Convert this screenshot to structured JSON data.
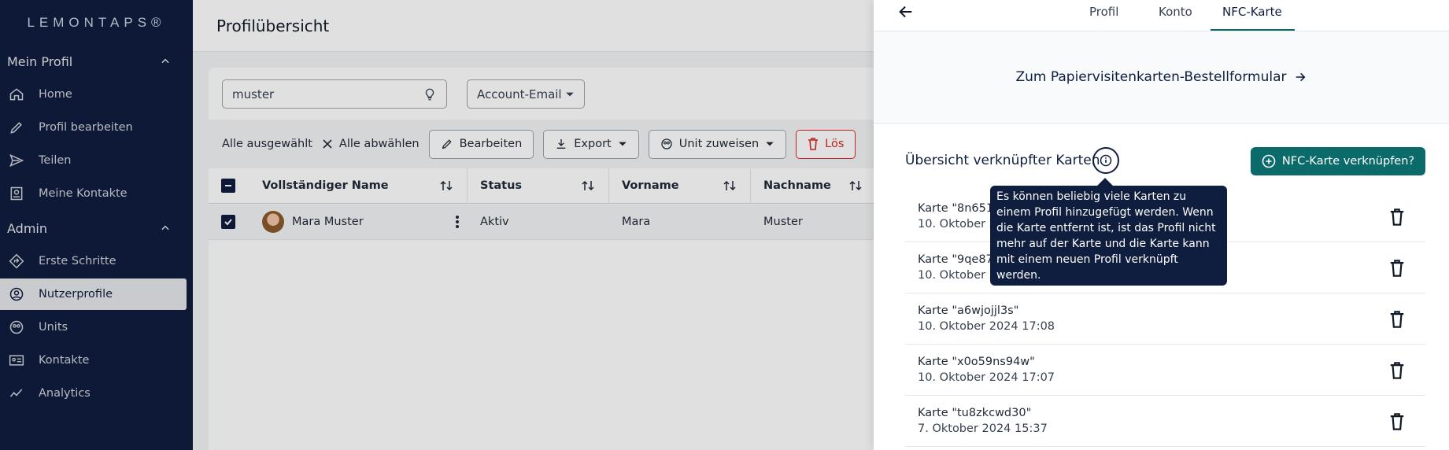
{
  "sidebar": {
    "logo": "LEMONTAPS®",
    "sections": [
      {
        "title": "Mein Profil",
        "items": [
          {
            "label": "Home",
            "icon": "home-icon"
          },
          {
            "label": "Profil bearbeiten",
            "icon": "pencil-icon"
          },
          {
            "label": "Teilen",
            "icon": "send-icon"
          },
          {
            "label": "Meine Kontakte",
            "icon": "contacts-icon"
          }
        ]
      },
      {
        "title": "Admin",
        "items": [
          {
            "label": "Erste Schritte",
            "icon": "diamond-direction-icon"
          },
          {
            "label": "Nutzerprofile",
            "icon": "user-circle-icon",
            "active": true
          },
          {
            "label": "Units",
            "icon": "units-icon"
          },
          {
            "label": "Kontakte",
            "icon": "id-card-icon"
          },
          {
            "label": "Analytics",
            "icon": "analytics-icon"
          }
        ]
      }
    ]
  },
  "main": {
    "title": "Profilübersicht",
    "search_value": "muster",
    "filter_select": "Account-Email",
    "toolbar": {
      "all_selected": "Alle ausgewählt",
      "deselect_all": "Alle abwählen",
      "edit": "Bearbeiten",
      "export": "Export",
      "assign_unit": "Unit zuweisen",
      "delete": "Lös"
    },
    "columns": [
      "Vollständiger Name",
      "Status",
      "Vorname",
      "Nachname"
    ],
    "rows": [
      {
        "full_name": "Mara Muster",
        "status": "Aktiv",
        "first_name": "Mara",
        "last_name": "Muster"
      }
    ]
  },
  "drawer": {
    "tabs": [
      "Profil",
      "Konto",
      "NFC-Karte"
    ],
    "active_tab": "NFC-Karte",
    "order_link": "Zum Papiervisitenkarten-Bestellformular",
    "overview_title": "Übersicht verknüpfter Karten",
    "link_button": "NFC-Karte verknüpfen?",
    "tooltip": "Es können beliebig viele Karten zu einem Profil hinzugefügt werden. Wenn die Karte entfernt ist, ist das Profil nicht mehr auf der Karte und die Karte kann mit einem neuen Profil verknüpft werden.",
    "cards": [
      {
        "name": "Karte \"8n651r",
        "date": "10. Oktober 20"
      },
      {
        "name": "Karte \"9qe87e",
        "date": "10. Oktober 20"
      },
      {
        "name": "Karte \"a6wjojjl3s\"",
        "date": "10. Oktober 2024 17:08"
      },
      {
        "name": "Karte \"x0o59ns94w\"",
        "date": "10. Oktober 2024 17:07"
      },
      {
        "name": "Karte \"tu8zkcwd30\"",
        "date": "7. Oktober 2024 15:37"
      }
    ]
  },
  "colors": {
    "navy": "#0f1d3e",
    "teal": "#0b6b6b",
    "danger": "#dc2626"
  }
}
